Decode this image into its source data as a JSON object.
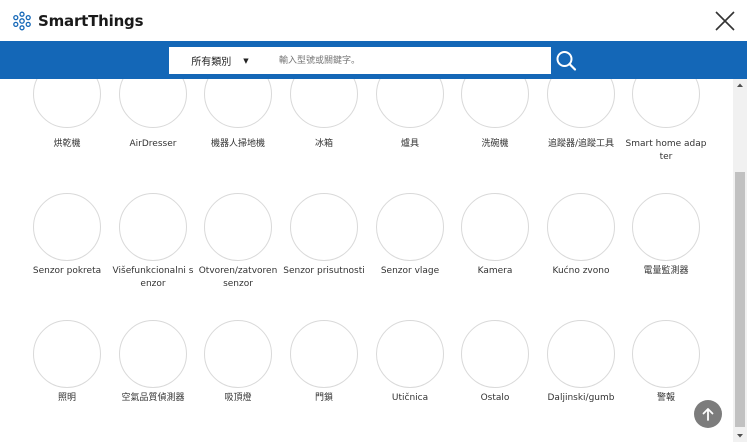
{
  "header": {
    "brand": "SmartThings"
  },
  "search": {
    "category_selected": "所有類別",
    "placeholder": "輸入型號或關鍵字。"
  },
  "devices": [
    {
      "label": "烘乾機"
    },
    {
      "label": "AirDresser"
    },
    {
      "label": "機器人掃地機"
    },
    {
      "label": "冰箱"
    },
    {
      "label": "爐具"
    },
    {
      "label": "洗碗機"
    },
    {
      "label": "追蹤器/追蹤工具"
    },
    {
      "label": "Smart home adapter"
    },
    {
      "label": "Senzor pokreta"
    },
    {
      "label": "Višefunkcionalni senzor"
    },
    {
      "label": "Otvoren/zatvoren senzor"
    },
    {
      "label": "Senzor prisutnosti"
    },
    {
      "label": "Senzor vlage"
    },
    {
      "label": "Kamera"
    },
    {
      "label": "Kućno zvono"
    },
    {
      "label": "電量監測器"
    },
    {
      "label": "照明"
    },
    {
      "label": "空氣品質偵測器"
    },
    {
      "label": "吸頂燈"
    },
    {
      "label": "門鎖"
    },
    {
      "label": "Utičnica"
    },
    {
      "label": "Ostalo"
    },
    {
      "label": "Daljinski/gumb"
    },
    {
      "label": "警報"
    }
  ],
  "colors": {
    "search_bar": "#1467b7",
    "circle_border": "#d9d9d9",
    "back_to_top": "#7c7c7c"
  },
  "icons": {
    "logo": "smartthings-logo-icon",
    "close": "close-icon",
    "search": "search-icon",
    "caret": "caret-down-icon",
    "back_to_top": "arrow-up-icon"
  }
}
